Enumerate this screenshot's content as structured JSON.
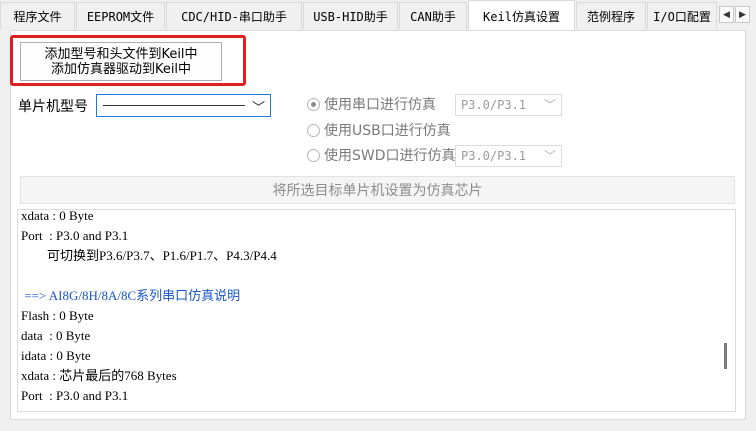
{
  "tabs": [
    {
      "label": "程序文件"
    },
    {
      "label": "EEPROM文件"
    },
    {
      "label": "CDC/HID-串口助手"
    },
    {
      "label": "USB-HID助手"
    },
    {
      "label": "CAN助手"
    },
    {
      "label": "Keil仿真设置"
    },
    {
      "label": "范例程序"
    },
    {
      "label": "I/O口配置"
    }
  ],
  "tab_nav": {
    "left": "◀",
    "right": "▶"
  },
  "add_button": {
    "line1": "添加型号和头文件到Keil中",
    "line2": "添加仿真器驱动到Keil中"
  },
  "mcu_model": {
    "label": "单片机型号",
    "chevron": "﹀"
  },
  "debug_modes": [
    {
      "label": "使用串口进行仿真",
      "checked": true,
      "port": "P3.0/P3.1"
    },
    {
      "label": "使用USB口进行仿真",
      "checked": false
    },
    {
      "label": "使用SWD口进行仿真",
      "checked": false,
      "port": "P3.0/P3.1"
    }
  ],
  "set_chip_button": "将所选目标单片机设置为仿真芯片",
  "log": [
    "xdata : 0 Byte",
    "Port  : P3.0 and P3.1",
    "        可切换到P3.6/P3.7、P1.6/P1.7、P4.3/P4.4",
    "",
    " ==> AI8G/8H/8A/8C系列串口仿真说明",
    "Flash : 0 Byte",
    "data  : 0 Byte",
    "idata : 0 Byte",
    "xdata : 芯片最后的768 Bytes",
    "Port  : P3.0 and P3.1"
  ],
  "colors": {
    "highlight": "#e02020",
    "log_heading": "#1a55c8"
  }
}
